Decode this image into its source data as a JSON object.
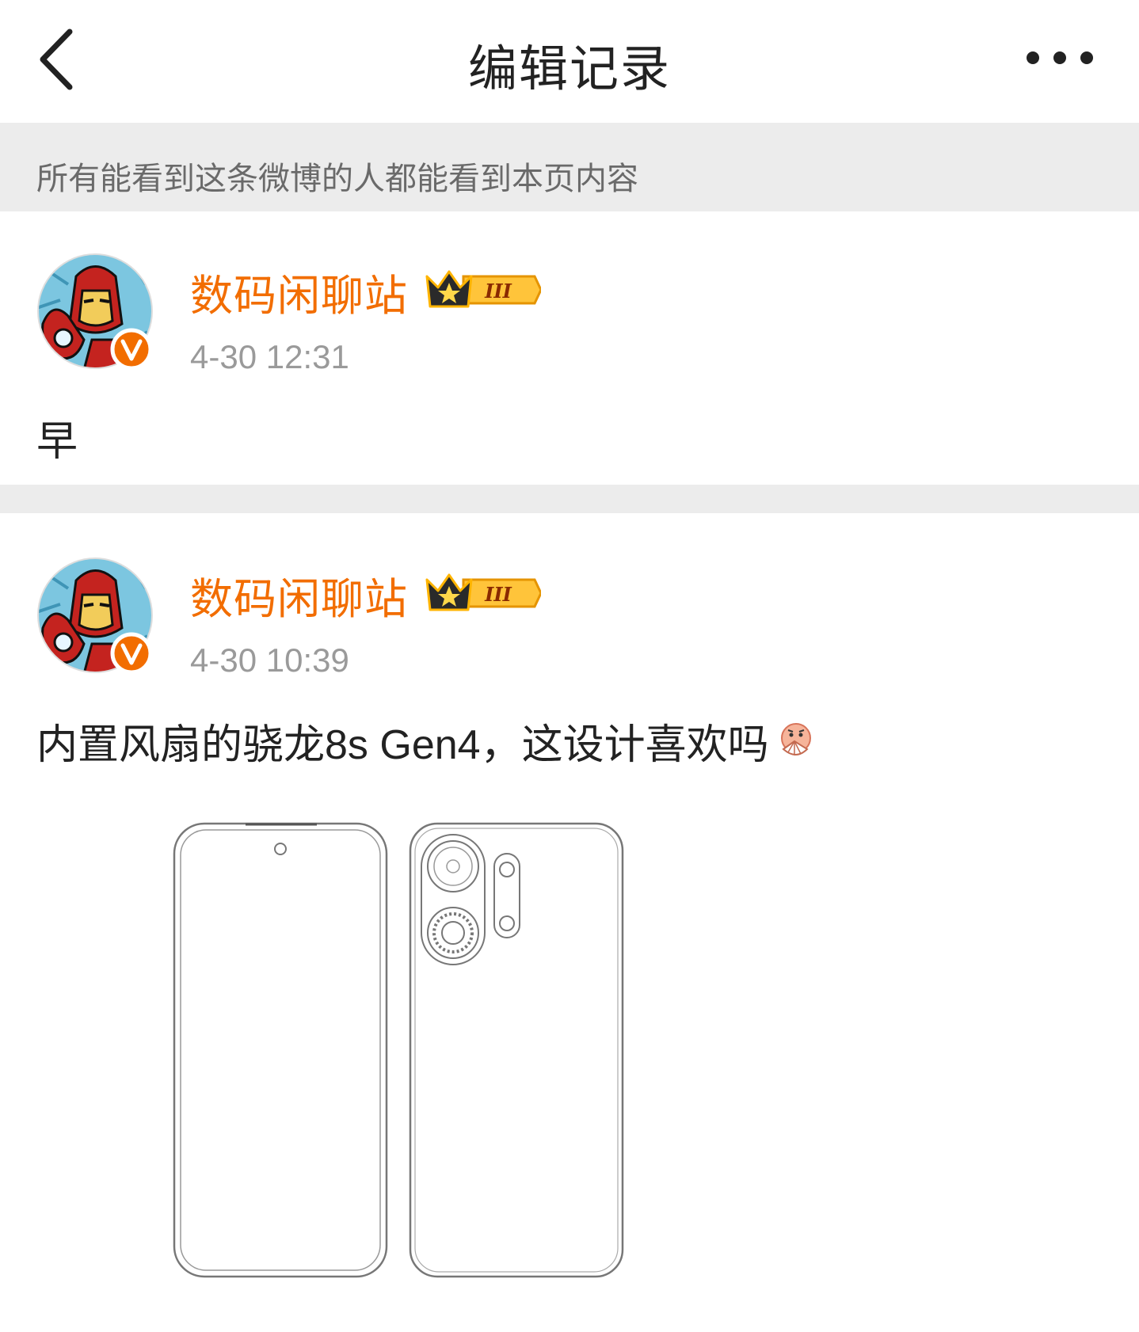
{
  "navbar": {
    "title": "编辑记录",
    "back_icon": "chevron-left-icon",
    "more_icon": "more-horizontal-icon"
  },
  "notice": {
    "text": "所有能看到这条微博的人都能看到本页内容"
  },
  "entries": [
    {
      "author": "数码闲聊站",
      "vip_level": "III",
      "timestamp": "4-30 12:31",
      "content": "早"
    },
    {
      "author": "数码闲聊站",
      "vip_level": "III",
      "timestamp": "4-30 10:39",
      "content_prefix": "内置风扇的骁龙",
      "content_latin": "8s Gen4",
      "content_suffix": "，这设计喜欢吗",
      "emoji": "fan-face-emoji",
      "image": "phone-front-back-sketch"
    }
  ],
  "colors": {
    "author": "#f26d00",
    "timestamp": "#9a9a9a",
    "notice_bg": "#ececec",
    "verified_badge": "#f26d00"
  }
}
